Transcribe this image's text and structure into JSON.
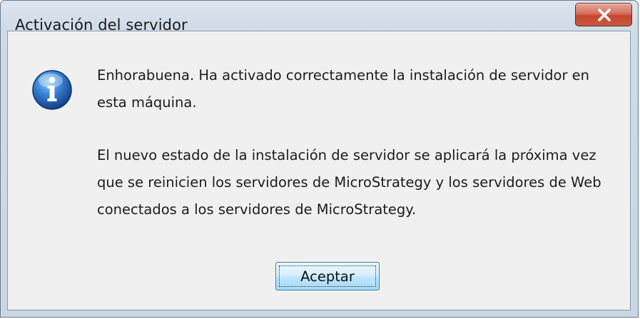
{
  "window": {
    "title": "Activación del servidor"
  },
  "message": {
    "line1": "Enhorabuena. Ha activado correctamente la instalación de servidor en esta máquina.",
    "line2": "El nuevo estado de la instalación de servidor se aplicará la próxima vez que se reinicien los servidores de MicroStrategy y los servidores de Web conectados a los servidores de MicroStrategy."
  },
  "buttons": {
    "ok_label": "Aceptar"
  },
  "icons": {
    "info": "info-icon",
    "close": "close-icon"
  },
  "colors": {
    "close_button": "#c8452f",
    "info_icon": "#1d63b8",
    "ok_button_border": "#3c7fb1"
  }
}
